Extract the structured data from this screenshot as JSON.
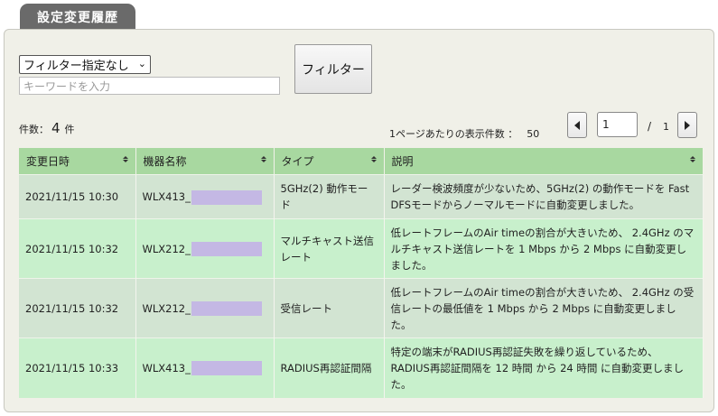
{
  "panel_title": "設定変更履歴",
  "filter": {
    "select_value": "フィルター指定なし",
    "keyword_placeholder": "キーワードを入力",
    "button_label": "フィルター"
  },
  "summary": {
    "count_label": "件数：",
    "count_value": "4",
    "count_unit": "件",
    "per_page_label": "1ページあたりの表示件数 ：",
    "per_page_value": "50"
  },
  "pager": {
    "current_page": "1",
    "separator": "/",
    "total_pages": "1",
    "prev_icon": "triangle-left-icon",
    "next_icon": "triangle-right-icon"
  },
  "table": {
    "columns": [
      "変更日時",
      "機器名称",
      "タイプ",
      "説明"
    ],
    "rows": [
      {
        "datetime": "2021/11/15 10:30",
        "device": "WLX413_",
        "type": "5GHz(2) 動作モード",
        "description": "レーダー検波頻度が少ないため、5GHz(2) の動作モードを Fast DFSモードからノーマルモードに自動変更しました。"
      },
      {
        "datetime": "2021/11/15 10:32",
        "device": "WLX212_",
        "type": "マルチキャスト送信レート",
        "description": "低レートフレームのAir timeの割合が大きいため、 2.4GHz のマルチキャスト送信レートを 1 Mbps から 2 Mbps に自動変更しました。"
      },
      {
        "datetime": "2021/11/15 10:32",
        "device": "WLX212_",
        "type": "受信レート",
        "description": "低レートフレームのAir timeの割合が大きいため、 2.4GHz の受信レートの最低値を 1 Mbps から 2 Mbps に自動変更しました。"
      },
      {
        "datetime": "2021/11/15 10:33",
        "device": "WLX413_",
        "type": "RADIUS再認証間隔",
        "description": "特定の端末がRADIUS再認証失敗を繰り返しているため、RADIUS再認証間隔を 12 時間 から 24 時間 に自動変更しました。"
      }
    ]
  },
  "colors": {
    "header_bg": "#a8d8a0",
    "row_odd_bg": "#d2e4d2",
    "row_even_bg": "#c8f0cc",
    "masked_bg": "#c4b8e4",
    "tab_bg": "#6a6a6a"
  }
}
